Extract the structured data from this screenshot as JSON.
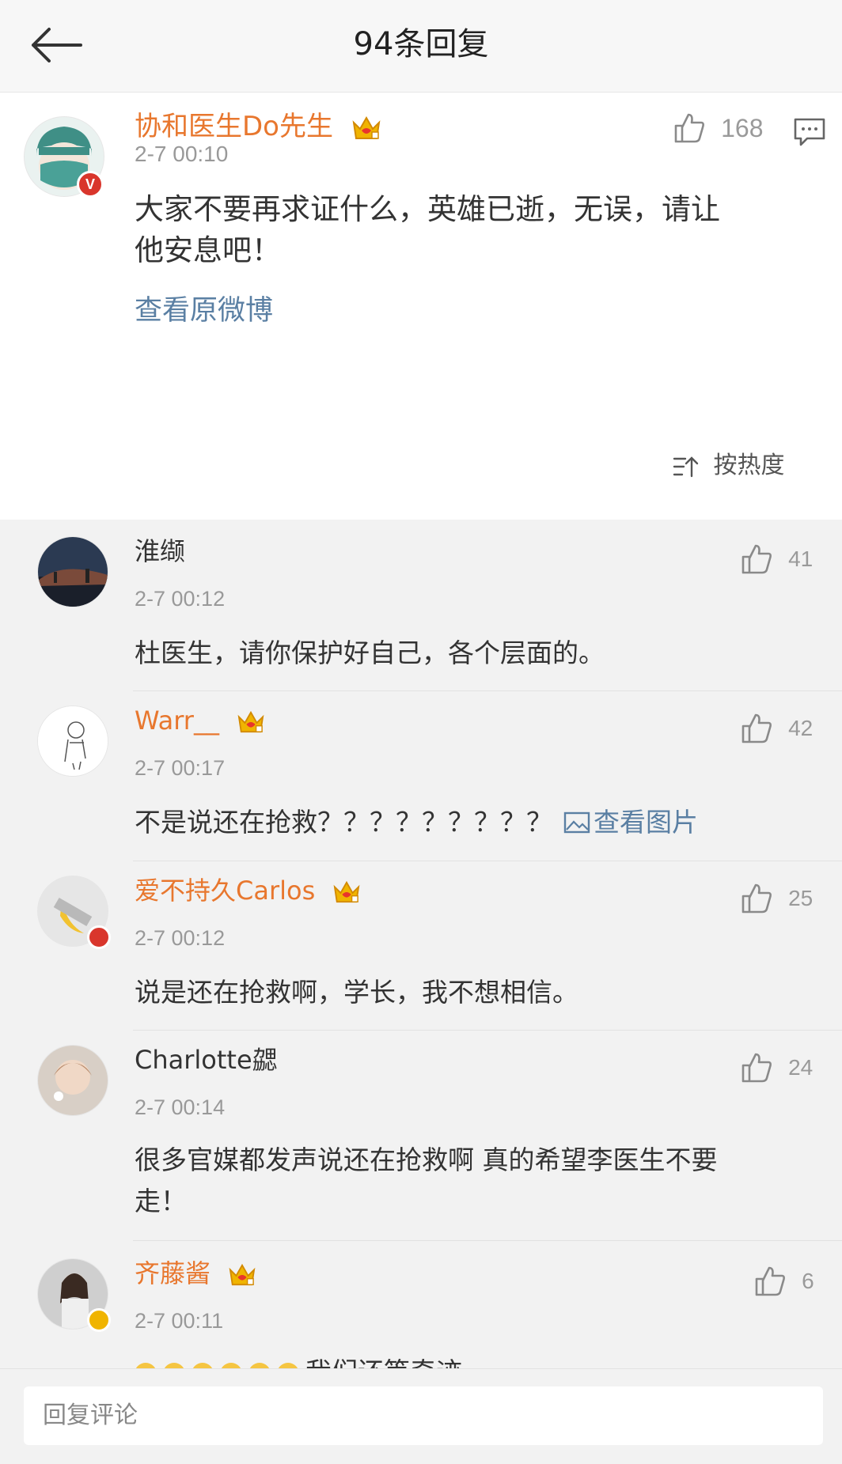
{
  "header": {
    "title": "94条回复"
  },
  "main_post": {
    "username": "协和医生Do先生",
    "time": "2-7 00:10",
    "text_lines": [
      "大家不要再求证什么，英雄已逝，无误，请让",
      "他安息吧！"
    ],
    "view_original": "查看原微博",
    "likes": "168",
    "verified": "V"
  },
  "sort": {
    "label": "按热度"
  },
  "comments": [
    {
      "username": "淮缬",
      "time": "2-7 00:12",
      "text": "杜医生，请你保护好自己，各个层面的。",
      "likes": "41"
    },
    {
      "username": "Warr__",
      "time": "2-7 00:17",
      "text": "不是说还在抢救？？？？？？？？？",
      "image_link": "查看图片",
      "likes": "42"
    },
    {
      "username": "爱不持久Carlos",
      "time": "2-7 00:12",
      "text": "说是还在抢救啊，学长，我不想相信。",
      "likes": "25"
    },
    {
      "username": "Charlotte勰",
      "time": "2-7 00:14",
      "text_lines": [
        "很多官媒都发声说还在抢救啊 真的希望李医生不要",
        "走！"
      ],
      "likes": "24"
    },
    {
      "username": "齐藤酱",
      "time": "2-7 00:11",
      "text": "我们还等奇迹",
      "likes": "6"
    }
  ],
  "reply_bar": {
    "placeholder": "回复评论"
  },
  "colors": {
    "username_orange": "#e8772e",
    "link_blue": "#5a7fa3",
    "verified_red": "#d9362c",
    "verified_gold": "#f0b400"
  },
  "icons": [
    "back-arrow-icon",
    "thumbs-up-icon",
    "comment-icon",
    "crown-icon",
    "sort-icon",
    "image-icon"
  ]
}
